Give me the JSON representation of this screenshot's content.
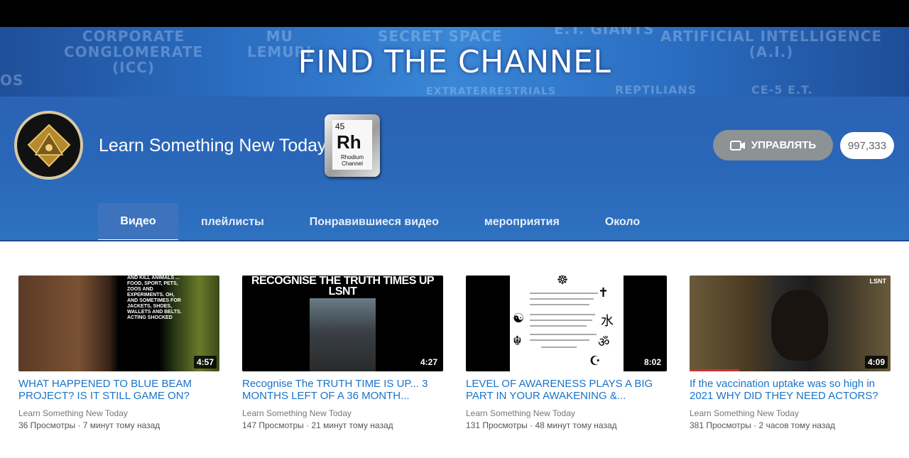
{
  "banner": {
    "headline": "FIND THE CHANNEL",
    "bg_words": [
      "CORPORATE\nCONGLOMERATE\n(ICC)",
      "MU\nLEMURI",
      "SECRET SPACE",
      "E.T. GIANTS",
      "ARTIFICIAL INTELLIGENCE\n(A.I.)",
      "EXTRATERRESTRIALS",
      "REPTILIANS",
      "CE-5 E.T.",
      "OS"
    ]
  },
  "channel": {
    "name": "Learn Something New Today",
    "badge": {
      "number": "45",
      "symbol": "Rh",
      "line1": "Rhodium",
      "line2": "Channel"
    },
    "manage_label": "УПРАВЛЯТЬ",
    "subscribers": "997,333"
  },
  "tabs": [
    {
      "label": "Видео",
      "active": true
    },
    {
      "label": "плейлисты",
      "active": false
    },
    {
      "label": "Понравившиеся видео",
      "active": false
    },
    {
      "label": "мероприятия",
      "active": false
    },
    {
      "label": "Около",
      "active": false
    }
  ],
  "videos": [
    {
      "title": "WHAT HAPPENED TO BLUE BEAM PROJECT? IS IT STILL GAME ON?",
      "channel": "Learn Something New Today",
      "meta": "36 Просмотры · 7 минут тому назад",
      "duration": "4:57",
      "thumb_text": "AND KILL ANIMALS ... FOOD, SPORT, PETS, ZOOS AND EXPERIMENTS. OH, AND SOMETIMES FOR JACKETS, SHOES, WALLETS AND BELTS. ACTING SHOCKED"
    },
    {
      "title": "Recognise The TRUTH TIME IS UP... 3 MONTHS LEFT OF A 36 MONTH...",
      "channel": "Learn Something New Today",
      "meta": "147 Просмотры · 21 минут тому назад",
      "duration": "4:27",
      "thumb_text": "RECOGNISE THE TRUTH TIMES UP LSNT"
    },
    {
      "title": "LEVEL OF AWARENESS PLAYS A BIG PART IN YOUR AWAKENING &...",
      "channel": "Learn Something New Today",
      "meta": "131 Просмотры · 48 минут тому назад",
      "duration": "8:02"
    },
    {
      "title": "If the vaccination uptake was so high in 2021 WHY DID THEY NEED ACTORS?",
      "channel": "Learn Something New Today",
      "meta": "381 Просмотры · 2 часов тому назад",
      "duration": "4:09",
      "thumb_text": "LSNT"
    }
  ],
  "colors": {
    "accent_link": "#1a73c8",
    "banner_blue": "#2a6cc0",
    "manage_button": "#8d9295"
  }
}
